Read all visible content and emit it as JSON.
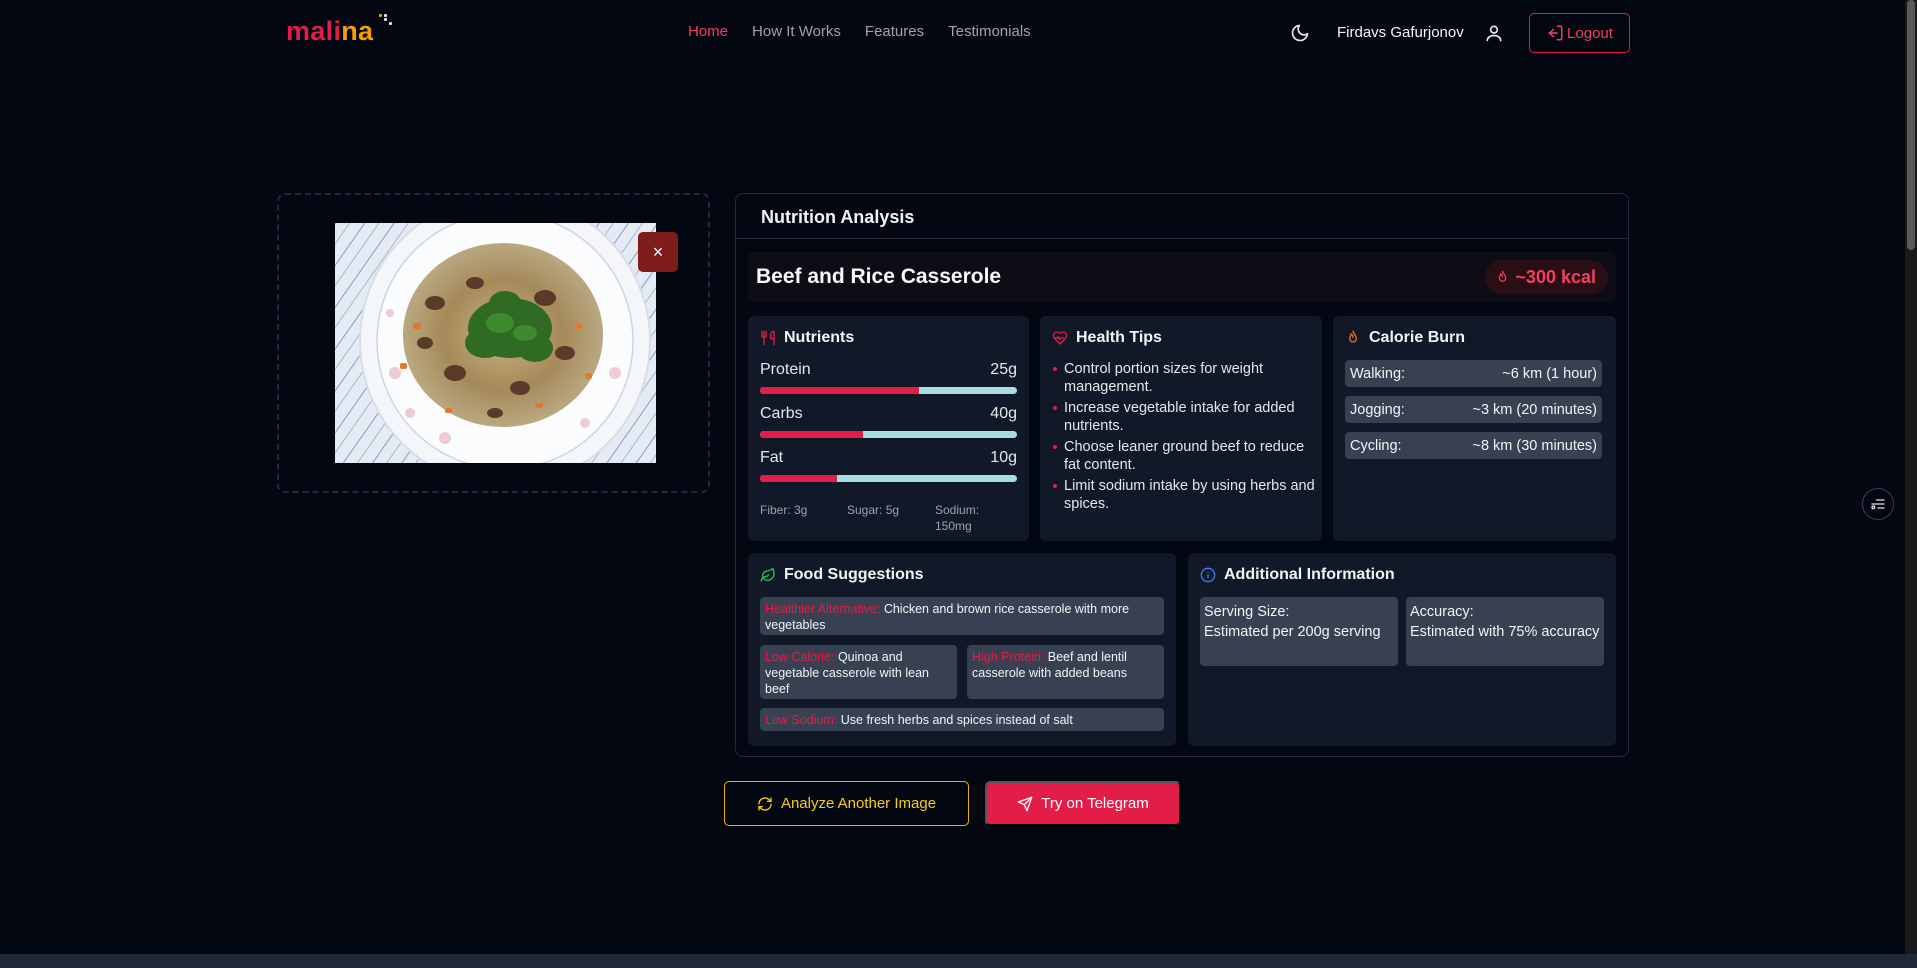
{
  "nav": {
    "logo_part1": "mal",
    "logo_part2": "i",
    "logo_part3": "n",
    "logo_part4": "a",
    "links": [
      "Home",
      "How It Works",
      "Features",
      "Testimonials"
    ],
    "active_link": "Home",
    "username": "Firdavs Gafurjonov",
    "logout_label": "Logout"
  },
  "upload": {
    "remove_label": "×",
    "image_icon": "food-photo"
  },
  "analysis": {
    "title": "Nutrition Analysis",
    "dish_name": "Beef and Rice Casserole",
    "calories": "~300 kcal",
    "nutrients": {
      "title": "Nutrients",
      "items": [
        {
          "name": "Protein",
          "value": "25g",
          "fill_percent": 62
        },
        {
          "name": "Carbs",
          "value": "40g",
          "fill_percent": 40
        },
        {
          "name": "Fat",
          "value": "10g",
          "fill_percent": 30
        }
      ],
      "fiber": "Fiber: 3g",
      "sugar": "Sugar: 5g",
      "sodium": "Sodium: 150mg"
    },
    "health_tips": {
      "title": "Health Tips",
      "items": [
        "Control portion sizes for weight management.",
        "Increase vegetable intake for added nutrients.",
        "Choose leaner ground beef to reduce fat content.",
        "Limit sodium intake by using herbs and spices."
      ]
    },
    "calorie_burn": {
      "title": "Calorie Burn",
      "rows": [
        {
          "activity": "Walking:",
          "value": "~6 km (1 hour)"
        },
        {
          "activity": "Jogging:",
          "value": "~3 km (20 minutes)"
        },
        {
          "activity": "Cycling:",
          "value": "~8 km (30 minutes)"
        }
      ]
    },
    "food_suggestions": {
      "title": "Food Suggestions",
      "healthier_label": "Healthier Alternative:",
      "healthier_text": " Chicken and brown rice casserole with more vegetables",
      "low_cal_label": "Low Calorie:",
      "low_cal_text": " Quinoa and vegetable casserole with lean beef",
      "high_protein_label": "High Protein:",
      "high_protein_text": " Beef and lentil casserole with added beans",
      "low_sodium_label": "Low Sodium:",
      "low_sodium_text": " Use fresh herbs and spices instead of salt"
    },
    "additional_info": {
      "title": "Additional Information",
      "serving_label": "Serving Size:",
      "serving_value": "Estimated per 200g serving",
      "accuracy_label": "Accuracy:",
      "accuracy_value": "Estimated with 75% accuracy"
    }
  },
  "actions": {
    "analyze_label": "Analyze Another Image",
    "telegram_label": "Try on Telegram"
  },
  "colors": {
    "accent": "#e11d48",
    "background": "#030712",
    "panel": "#111827",
    "bar_track": "#a5dde3",
    "analyze_border": "#eab308"
  }
}
